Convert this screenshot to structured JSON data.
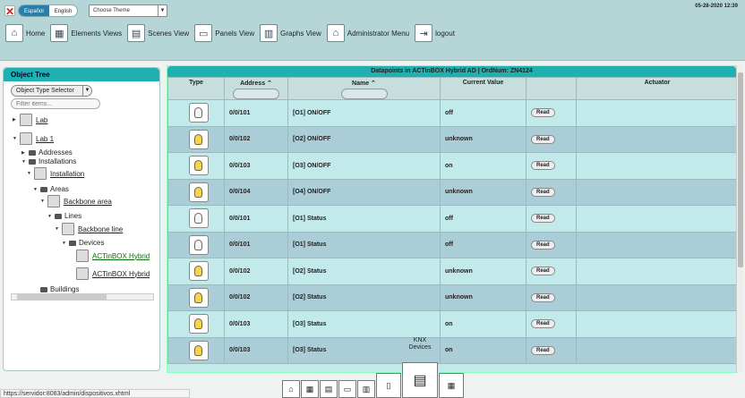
{
  "header": {
    "lang_es": "Español",
    "lang_en": "English",
    "theme_placeholder": "Choose Theme",
    "date": "05-28-2020 12:39",
    "nav": [
      {
        "label": "Home",
        "icon": "home-icon"
      },
      {
        "label": "Elements Views",
        "icon": "elements-icon"
      },
      {
        "label": "Scenes View",
        "icon": "scenes-icon"
      },
      {
        "label": "Panels View",
        "icon": "panels-icon"
      },
      {
        "label": "Graphs View",
        "icon": "graphs-icon"
      },
      {
        "label": "Administrator Menu",
        "icon": "admin-icon"
      },
      {
        "label": "logout",
        "icon": "logout-icon"
      }
    ]
  },
  "left": {
    "title": "Object Tree",
    "selector": "Object Type Selector",
    "filter_placeholder": "Filter items...",
    "tree": {
      "lab": "Lab",
      "lab1": "Lab 1",
      "addresses": "Addresses",
      "installations": "Installations",
      "installation": "Installation",
      "areas": "Areas",
      "backbone_area": "Backbone area",
      "lines": "Lines",
      "backbone_line": "Backbone line",
      "devices": "Devices",
      "dev1": "ACTinBOX Hybrid",
      "dev2": "ACTinBOX Hybrid",
      "buildings": "Buildings"
    }
  },
  "main": {
    "title": "Datapoints in ACTinBOX Hybrid AD | OrdNum: ZN4124",
    "columns": {
      "type": "Type",
      "address": "Address ⌃",
      "name": "Name ⌃",
      "value": "Current Value",
      "actuator": "Actuator"
    },
    "read_label": "Read",
    "rows": [
      {
        "address": "0/0/101",
        "name": "[O1] ON/OFF",
        "value": "off",
        "on": false
      },
      {
        "address": "0/0/102",
        "name": "[O2] ON/OFF",
        "value": "unknown",
        "on": true
      },
      {
        "address": "0/0/103",
        "name": "[O3] ON/OFF",
        "value": "on",
        "on": true
      },
      {
        "address": "0/0/104",
        "name": "[O4] ON/OFF",
        "value": "unknown",
        "on": true
      },
      {
        "address": "0/0/101",
        "name": "[O1] Status",
        "value": "off",
        "on": false
      },
      {
        "address": "0/0/101",
        "name": "[O1] Status",
        "value": "off",
        "on": false
      },
      {
        "address": "0/0/102",
        "name": "[O2] Status",
        "value": "unknown",
        "on": true
      },
      {
        "address": "0/0/102",
        "name": "[O2] Status",
        "value": "unknown",
        "on": true
      },
      {
        "address": "0/0/103",
        "name": "[O3] Status",
        "value": "on",
        "on": true
      },
      {
        "address": "0/0/103",
        "name": "[O3] Status",
        "value": "on",
        "on": true
      }
    ]
  },
  "dock": {
    "tooltip": "KNX Devices"
  },
  "status_url": "https://servidor:8083/admin/dispositivos.xhtml"
}
